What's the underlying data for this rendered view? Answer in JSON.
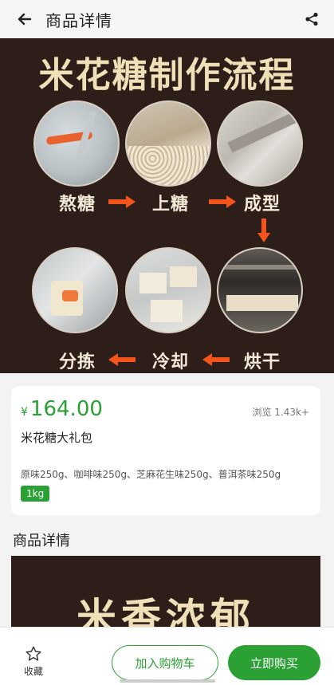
{
  "header": {
    "title": "商品详情",
    "back_icon": "arrow-left-icon",
    "share_icon": "share-icon"
  },
  "hero": {
    "title": "米花糖制作流程",
    "steps": [
      "熬糖",
      "上糖",
      "成型",
      "烘干",
      "冷却",
      "分拣"
    ]
  },
  "product": {
    "currency": "¥",
    "price": "164.00",
    "views": "浏览 1.43k+",
    "name": "米花糖大礼包",
    "spec": "原味250g、咖啡味250g、芝麻花生味250g、普洱茶味250g",
    "tag": "1kg"
  },
  "details": {
    "title": "商品详情",
    "image_text": "米香浓郁"
  },
  "bottom": {
    "favorite_label": "收藏",
    "cart_label": "加入购物车",
    "buy_label": "立即购买"
  },
  "colors": {
    "accent": "#2aa035",
    "hero_bg": "#2e1e1a",
    "arrow": "#f2541b"
  }
}
